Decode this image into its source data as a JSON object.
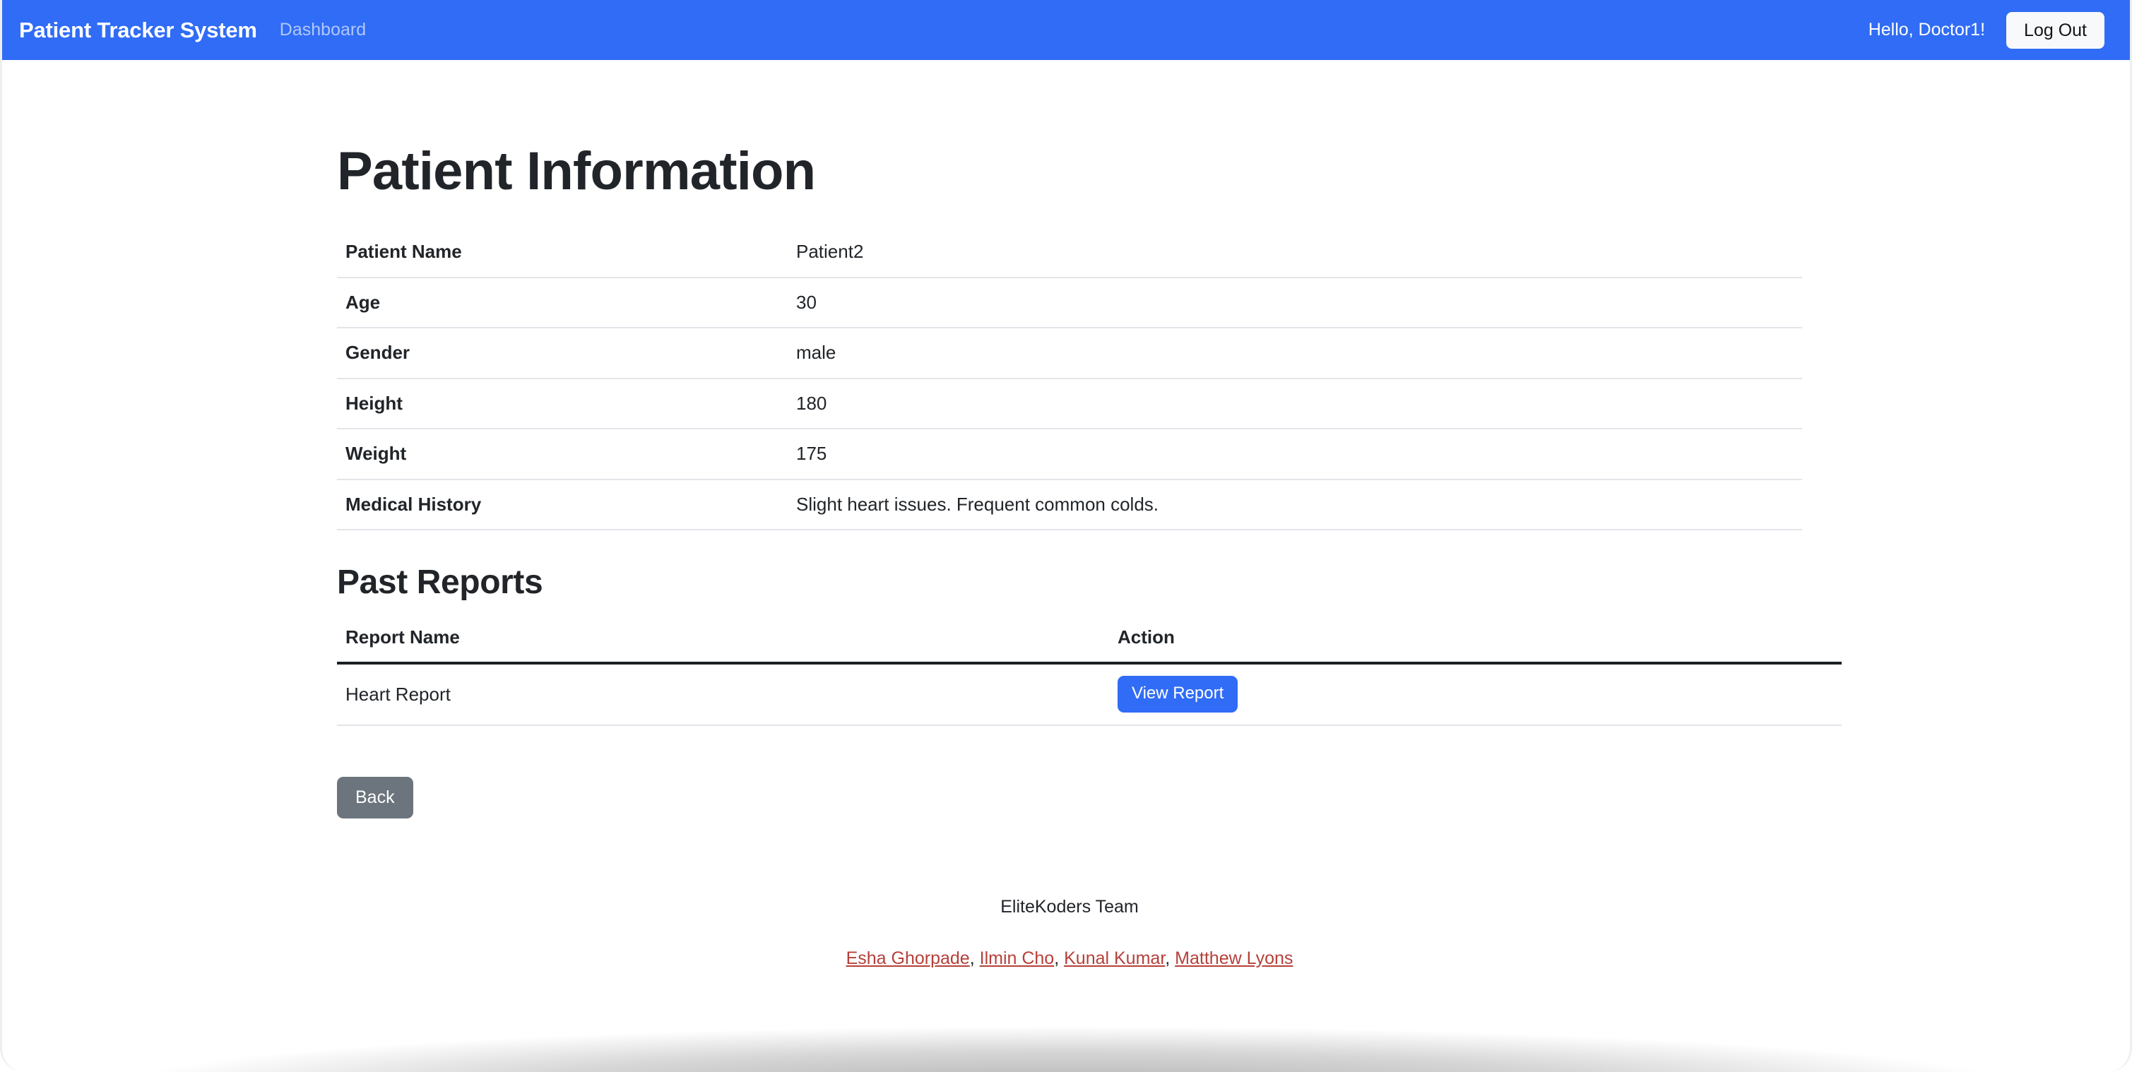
{
  "navbar": {
    "brand": "Patient Tracker System",
    "dashboard_link": "Dashboard",
    "greeting": "Hello, Doctor1!",
    "logout_label": "Log Out",
    "background_color": "#306cf5"
  },
  "main": {
    "page_title": "Patient Information",
    "patient_info": {
      "rows": [
        {
          "label": "Patient Name",
          "value": "Patient2"
        },
        {
          "label": "Age",
          "value": "30"
        },
        {
          "label": "Gender",
          "value": "male"
        },
        {
          "label": "Height",
          "value": "180"
        },
        {
          "label": "Weight",
          "value": "175"
        },
        {
          "label": "Medical History",
          "value": "Slight heart issues. Frequent common colds."
        }
      ]
    },
    "past_reports": {
      "section_title": "Past Reports",
      "columns": [
        "Report Name",
        "Action"
      ],
      "rows": [
        {
          "name": "Heart Report",
          "action_label": "View Report"
        }
      ]
    },
    "back_label": "Back"
  },
  "footer": {
    "team": "EliteKoders Team",
    "credits": [
      "Esha Ghorpade",
      "Ilmin Cho",
      "Kunal Kumar",
      "Matthew Lyons"
    ],
    "separator": ", ",
    "link_color": "#b5403a"
  }
}
